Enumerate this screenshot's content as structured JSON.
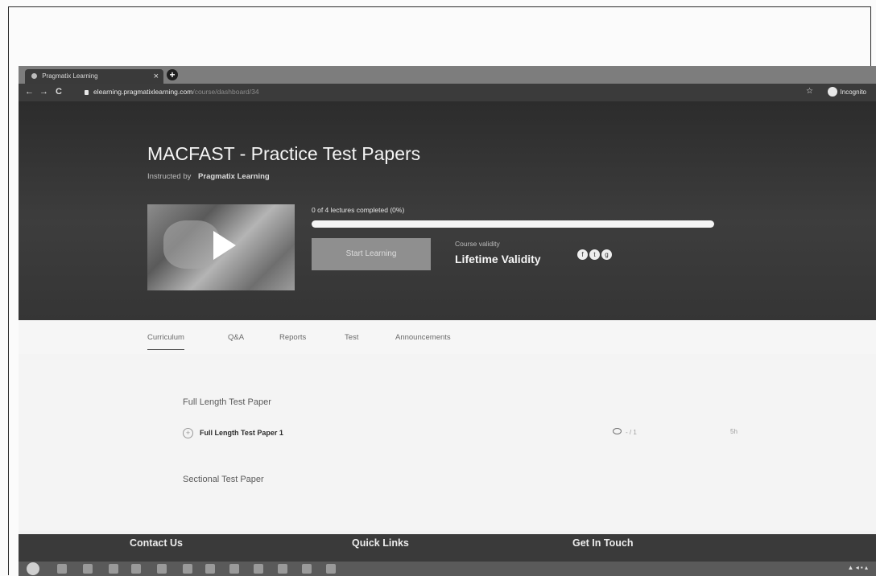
{
  "browser": {
    "tab_title": "Pragmatix Learning",
    "tab_close": "×",
    "new_tab": "+",
    "url_domain": "elearning.pragmatixlearning.com",
    "url_path": "/course/dashboard/34",
    "nav_back": "←",
    "nav_forward": "→",
    "nav_reload": "C",
    "bookmark": "☆",
    "profile": "Incognito"
  },
  "course": {
    "title": "MACFAST - Practice Test Papers",
    "instructed_by_label": "Instructed by",
    "instructor": "Pragmatix Learning",
    "progress_text": "0 of 4 lectures completed (0%)",
    "progress": 0,
    "start_button": "Start Learning",
    "validity_label": "Course validity",
    "validity_value": "Lifetime Validity"
  },
  "tabs": [
    {
      "label": "Curriculum",
      "active": true
    },
    {
      "label": "Q&A"
    },
    {
      "label": "Reports"
    },
    {
      "label": "Test"
    },
    {
      "label": "Announcements"
    }
  ],
  "curriculum": {
    "sections": [
      {
        "title": "Full Length Test Paper",
        "lectures": [
          {
            "title": "Full Length Test Paper 1",
            "views": "- / 1",
            "duration": "5h"
          }
        ]
      },
      {
        "title": "Sectional Test Paper",
        "lectures": []
      }
    ]
  },
  "footer": {
    "contact": "Contact Us",
    "quick_links": "Quick Links",
    "get_in_touch": "Get In Touch"
  },
  "social_icons": [
    "facebook-icon",
    "twitter-icon",
    "google-icon"
  ],
  "colors": {
    "hero_bg": "#353535",
    "progress_fill": "#4a90d9",
    "start_button": "#8f8f8f"
  }
}
